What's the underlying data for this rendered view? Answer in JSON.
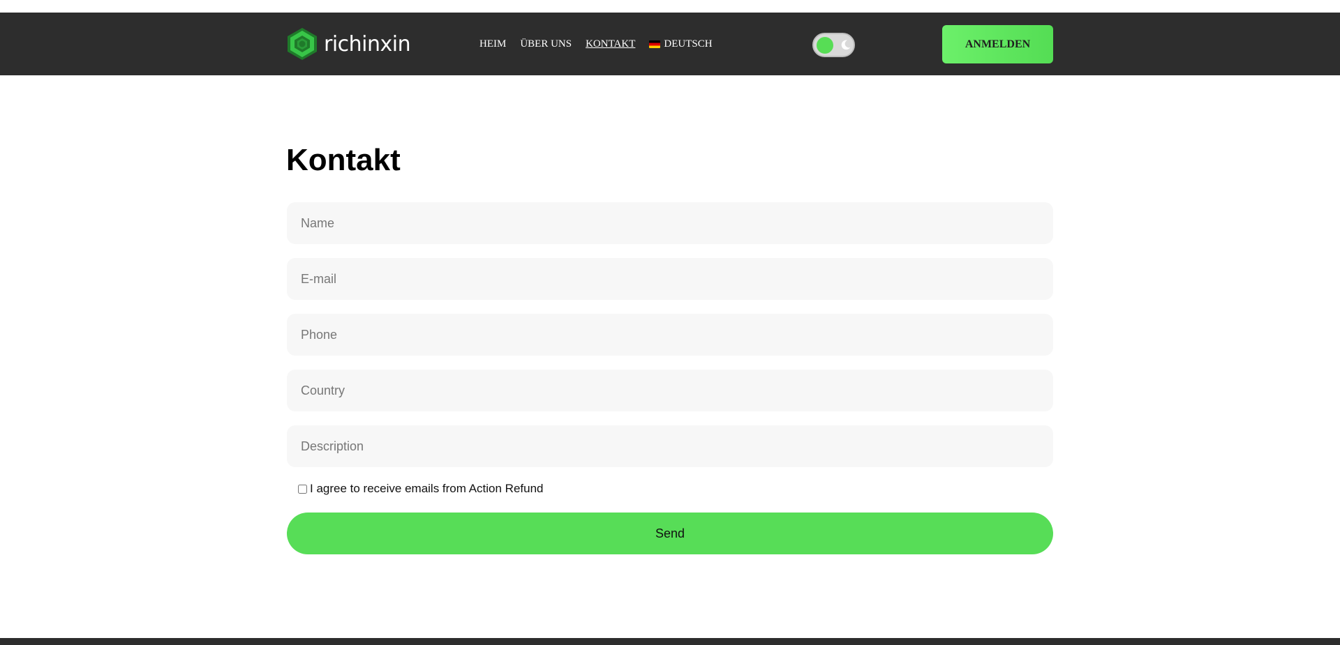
{
  "brand": {
    "name": "richinxin",
    "logo_icon": "hexagon-logo-icon",
    "accent_color": "#57dd57"
  },
  "nav": {
    "items": [
      {
        "label": "HEIM",
        "active": false
      },
      {
        "label": "ÜBER UNS",
        "active": false
      },
      {
        "label": "KONTAKT",
        "active": true
      }
    ],
    "language": {
      "label": "DEUTSCH",
      "flag_icon": "germany-flag-icon"
    },
    "theme_toggle": {
      "icon": "moon-icon",
      "state": "light"
    },
    "login_label": "ANMELDEN"
  },
  "page": {
    "title": "Kontakt"
  },
  "form": {
    "name_placeholder": "Name",
    "email_placeholder": "E-mail",
    "phone_placeholder": "Phone",
    "country_placeholder": "Country",
    "description_placeholder": "Description",
    "agree_label": "I agree to receive emails from Action Refund",
    "agree_checked": false,
    "send_label": "Send"
  }
}
